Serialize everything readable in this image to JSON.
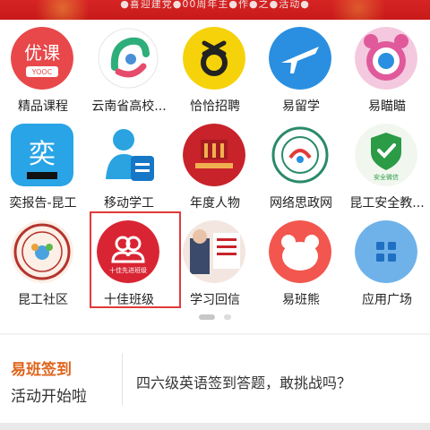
{
  "banner": {
    "text": "●喜迎建党●00周年主●作●之●活动●"
  },
  "apps": [
    {
      "label": "精品课程",
      "icon": "youke-icon"
    },
    {
      "label": "云南省高校...",
      "icon": "yunnan-icon"
    },
    {
      "label": "恰恰招聘",
      "icon": "qiaqia-icon"
    },
    {
      "label": "易留学",
      "icon": "airplane-icon"
    },
    {
      "label": "易瞄瞄",
      "icon": "camera-eye-icon"
    },
    {
      "label": "奕报告-昆工",
      "icon": "yi-report-icon"
    },
    {
      "label": "移动学工",
      "icon": "person-doc-icon"
    },
    {
      "label": "年度人物",
      "icon": "annual-person-icon"
    },
    {
      "label": "网络思政网",
      "icon": "seal-icon"
    },
    {
      "label": "昆工安全教...",
      "icon": "shield-check-icon"
    },
    {
      "label": "昆工社区",
      "icon": "community-seal-icon"
    },
    {
      "label": "十佳班级",
      "icon": "top-class-icon"
    },
    {
      "label": "学习回信",
      "icon": "study-letter-icon"
    },
    {
      "label": "易班熊",
      "icon": "bear-icon"
    },
    {
      "label": "应用广场",
      "icon": "app-grid-icon"
    }
  ],
  "icon_text": {
    "youke_main": "优课",
    "youke_sub": "YOOC",
    "yi_char": "奕",
    "safety_text": "安全微信",
    "top_class_text": "十佳先进班级"
  },
  "checkin": {
    "title": "易班签到",
    "subtitle": "活动开始啦",
    "promo": "四六级英语签到答题，敢挑战吗？"
  },
  "pager": {
    "pages": 2,
    "current": 1
  },
  "colors": {
    "banner": "#d62424",
    "highlight": "#e23a3a",
    "checkin_title": "#e0651e"
  }
}
